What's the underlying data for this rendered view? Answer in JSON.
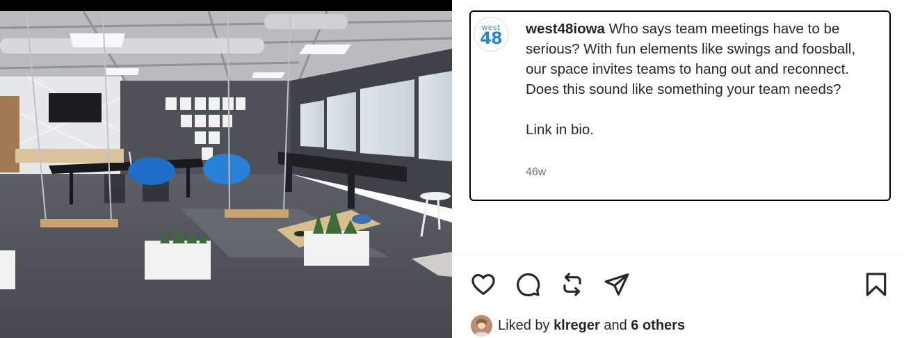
{
  "post": {
    "author": {
      "username": "west48iowa",
      "avatar_top": "west",
      "avatar_bottom": "48"
    },
    "caption_line1": "Who says team meetings have to be serious? With fun elements like swings and foosball, our space invites teams to hang out and reconnect. Does this sound like something your team needs?",
    "caption_line2": "Link in bio.",
    "timestamp": "46w",
    "likes": {
      "prefix": "Liked by",
      "first_liker": "klreger",
      "conjunction": "and",
      "others": "6 others"
    }
  },
  "icons": {
    "like": "heart-icon",
    "comment": "comment-icon",
    "repost": "repost-icon",
    "share": "send-icon",
    "save": "bookmark-icon"
  },
  "colors": {
    "text": "#262626",
    "muted": "#737373",
    "brand_blue": "#2c86c8",
    "border": "#000000"
  }
}
